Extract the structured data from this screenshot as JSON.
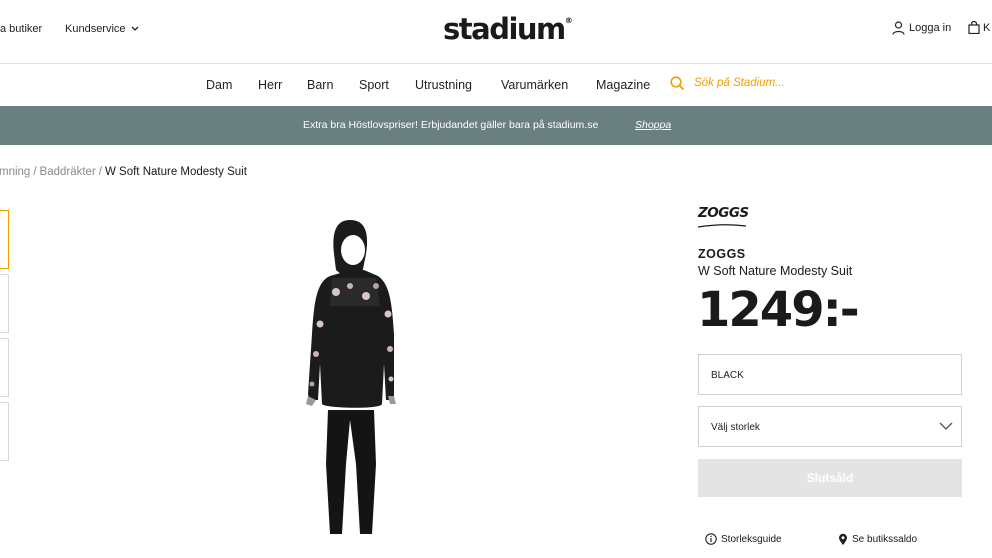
{
  "header": {
    "left_links": [
      "a butiker",
      "Kundservice"
    ],
    "logo": "stadium",
    "logo_mark": "®",
    "login_label": "Logga in",
    "cart_label": "K"
  },
  "nav": {
    "items": [
      "Dam",
      "Herr",
      "Barn",
      "Sport",
      "Utrustning",
      "Varumärken",
      "Magazine"
    ],
    "search_placeholder": "Sök på Stadium..."
  },
  "promo": {
    "text": "Extra bra Höstlovspriser! Erbjudandet gäller bara på stadium.se",
    "link": "Shoppa"
  },
  "breadcrumb": {
    "items": [
      "mning",
      "Baddräkter"
    ],
    "current": "W Soft Nature Modesty Suit",
    "separator": "/"
  },
  "product": {
    "brand_logo_text": "ZOGGS",
    "brand": "ZOGGS",
    "name": "W Soft Nature Modesty Suit",
    "price": "1249:-",
    "color": "BLACK",
    "size_placeholder": "Välj storlek",
    "button_label": "Slutsåld",
    "size_guide_label": "Storleksguide",
    "store_stock_label": "Se butikssaldo"
  },
  "colors": {
    "accent": "#f0a000",
    "promo_bg": "#6a7f80",
    "disabled_button": "#e4e4e4"
  }
}
